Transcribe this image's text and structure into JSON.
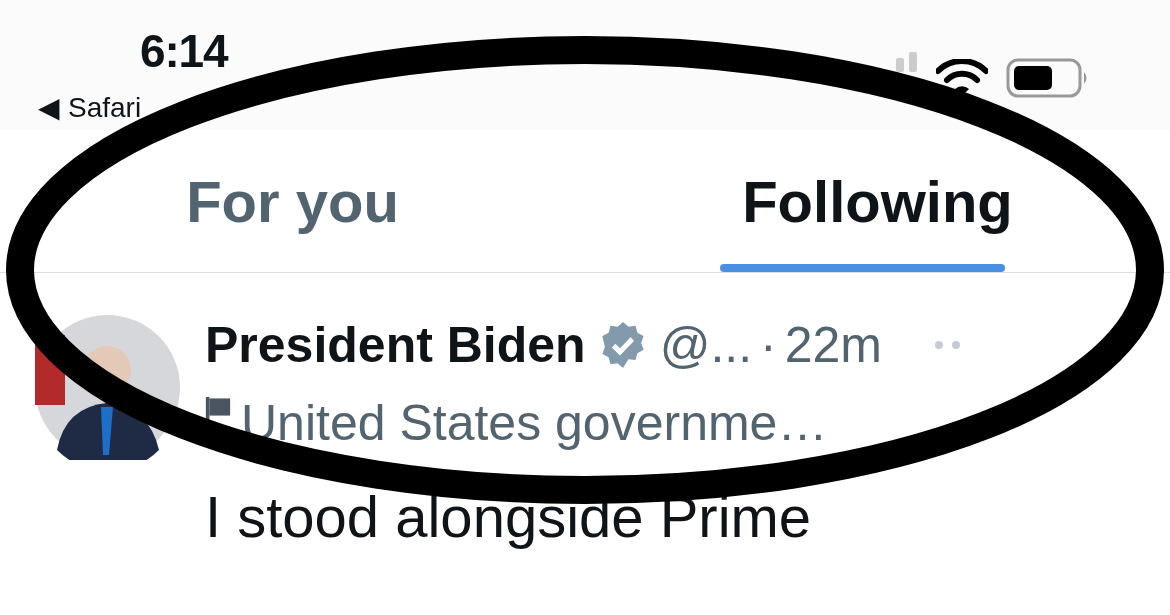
{
  "status_bar": {
    "time": "6:14",
    "back_label": "Safari",
    "back_glyph": "◀"
  },
  "tabs": [
    {
      "label": "For you",
      "selected": false
    },
    {
      "label": "Following",
      "selected": true
    }
  ],
  "tweet": {
    "name": "President Biden",
    "verified": true,
    "handle": "@...",
    "separator": "·",
    "time": "22m",
    "affiliation": "United States governme…",
    "text": "I stood alongside Prime"
  }
}
